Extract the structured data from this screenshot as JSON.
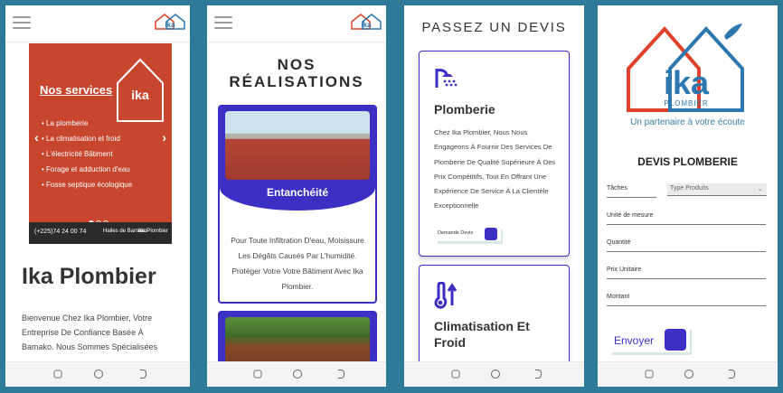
{
  "screen1": {
    "banner": {
      "title": "Nos services",
      "items": [
        "La plomberie",
        "La climatisation et froid",
        "L'électricité Bâtiment",
        "Forage et adduction d'eau",
        "Fosse septique écologique"
      ],
      "phone": "(+225)74 24 00 74",
      "address": "Halles de Bamako",
      "facebook": "Ika Plombier"
    },
    "title": "Ika Plombier",
    "intro": "Bienvenue Chez Ika Plombier, Votre Entreprise De Confiance Basée À Bamako. Nous Sommes Spécialisées"
  },
  "screen2": {
    "title": "NOS RÉALISATIONS",
    "card1": {
      "label": "Entanchéité",
      "text": "Pour Toute Infiltration D'eau, Moisissure Les Dégâts Causés Par L'humidité. Protéger Votre Votre Bâtiment Avec Ika Plombier."
    }
  },
  "screen3": {
    "title": "PASSEZ UN DEVIS",
    "services": [
      {
        "name": "Plomberie",
        "icon": "shower-icon",
        "description": "Chez Ika Plombier, Nous Nous Engageons À Fournir Des Services De Plomberie De Qualité Supérieure À Des Prix Compétitifs, Tout En Offrant Une Expérience De Service À La Clientèle Exceptionnelle",
        "button": "Demande Devis"
      },
      {
        "name": "Climatisation Et Froid",
        "icon": "temperature-icon"
      }
    ]
  },
  "screen4": {
    "logo_text": "ika",
    "logo_sub": "PLOMBIER",
    "tagline": "Un partenaire à votre écoute",
    "form_title": "DEVIS PLOMBERIE",
    "fields": {
      "taches": "Tâches",
      "type_select": "Type Produits",
      "unite": "Unité de mesure",
      "quantite": "Quantité",
      "prix": "Prix Unitaire",
      "montant": "Montant"
    },
    "submit": "Envoyer"
  },
  "colors": {
    "background": "#2e7a98",
    "accent": "#3b2fc4",
    "banner": "#c9462e",
    "logo_red": "#e0412b",
    "logo_blue": "#2c77b0"
  }
}
